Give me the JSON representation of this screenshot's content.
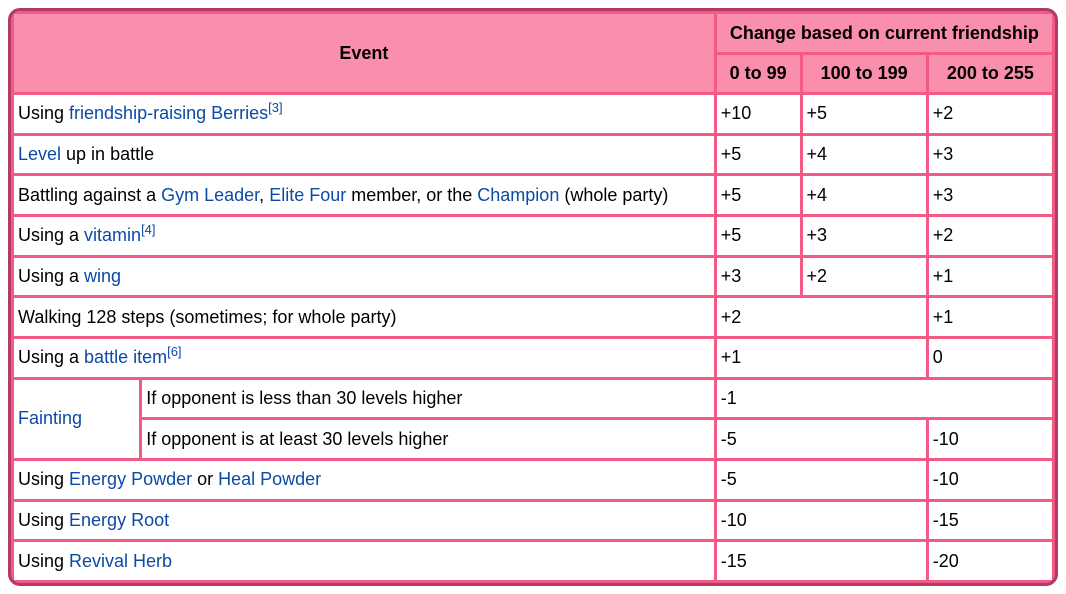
{
  "header": {
    "event": "Event",
    "change_group": "Change based on current friendship",
    "ranges": [
      "0 to 99",
      "100 to 199",
      "200 to 255"
    ]
  },
  "rows": {
    "berries": {
      "prefix": "Using ",
      "link": "friendship-raising Berries",
      "ref": "[3]",
      "values": [
        "+10",
        "+5",
        "+2"
      ]
    },
    "level": {
      "link": "Level",
      "suffix": " up in battle",
      "values": [
        "+5",
        "+4",
        "+3"
      ]
    },
    "battling": {
      "prefix": "Battling against a ",
      "link1": "Gym Leader",
      "mid1": ", ",
      "link2": "Elite Four",
      "mid2": " member, or the ",
      "link3": "Champion",
      "suffix": " (whole party)",
      "values": [
        "+5",
        "+4",
        "+3"
      ]
    },
    "vitamin": {
      "prefix": "Using a ",
      "link": "vitamin",
      "ref": "[4]",
      "values": [
        "+5",
        "+3",
        "+2"
      ]
    },
    "wing": {
      "prefix": "Using a ",
      "link": "wing",
      "values": [
        "+3",
        "+2",
        "+1"
      ]
    },
    "walking": {
      "text": "Walking 128 steps (sometimes; for whole party)",
      "values": [
        "+2",
        "+1"
      ]
    },
    "battle_item": {
      "prefix": "Using a ",
      "link": "battle item",
      "ref": "[6]",
      "values": [
        "+1",
        "0"
      ]
    },
    "fainting": {
      "link": "Fainting",
      "sub": [
        {
          "condition": "If opponent is less than 30 levels higher",
          "values": [
            "-1"
          ]
        },
        {
          "condition": "If opponent is at least 30 levels higher",
          "values": [
            "-5",
            "-10"
          ]
        }
      ]
    },
    "powder": {
      "prefix": "Using ",
      "link1": "Energy Powder",
      "mid": " or ",
      "link2": "Heal Powder",
      "values": [
        "-5",
        "-10"
      ]
    },
    "root": {
      "prefix": "Using ",
      "link": "Energy Root",
      "values": [
        "-10",
        "-15"
      ]
    },
    "herb": {
      "prefix": "Using ",
      "link": "Revival Herb",
      "values": [
        "-15",
        "-20"
      ]
    }
  },
  "colors": {
    "header_bg": "#f98fac",
    "grid": "#f45a86",
    "outer_border": "#b03c64",
    "link": "#0b4aa6"
  }
}
